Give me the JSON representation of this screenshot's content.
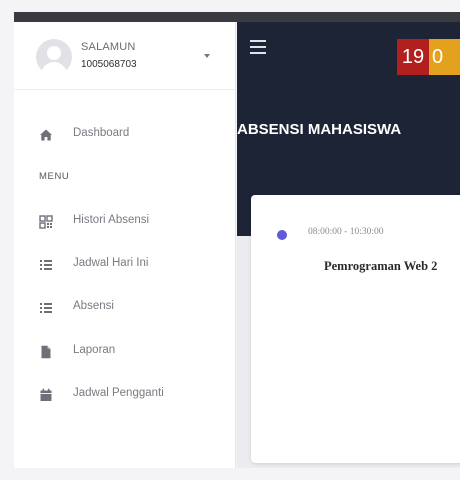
{
  "user": {
    "name": "SALAMUN",
    "id": "1005068703"
  },
  "sidebar": {
    "dashboard_label": "Dashboard",
    "section_label": "MENU",
    "items": [
      {
        "label": "Histori Absensi",
        "icon": "qr-grid-icon"
      },
      {
        "label": "Jadwal Hari Ini",
        "icon": "list-icon"
      },
      {
        "label": "Absensi",
        "icon": "list-icon"
      },
      {
        "label": "Laporan",
        "icon": "file-icon"
      },
      {
        "label": "Jadwal Pengganti",
        "icon": "calendar-icon"
      }
    ]
  },
  "navbar": {
    "menu_icon": "hamburger-icon",
    "clock_left": "19",
    "clock_right": "0"
  },
  "main": {
    "page_title": "ABSENSI MAHASISWA",
    "schedule": {
      "time": "08:00:00 - 10:30:00",
      "course": "Pemrograman Web 2"
    }
  },
  "colors": {
    "sidebar_bg": "#ffffff",
    "navbar_bg": "#1c2436",
    "accent_dot": "#5f5bd6",
    "clock_red": "#b21f1f",
    "clock_orange": "#e3a11d"
  }
}
